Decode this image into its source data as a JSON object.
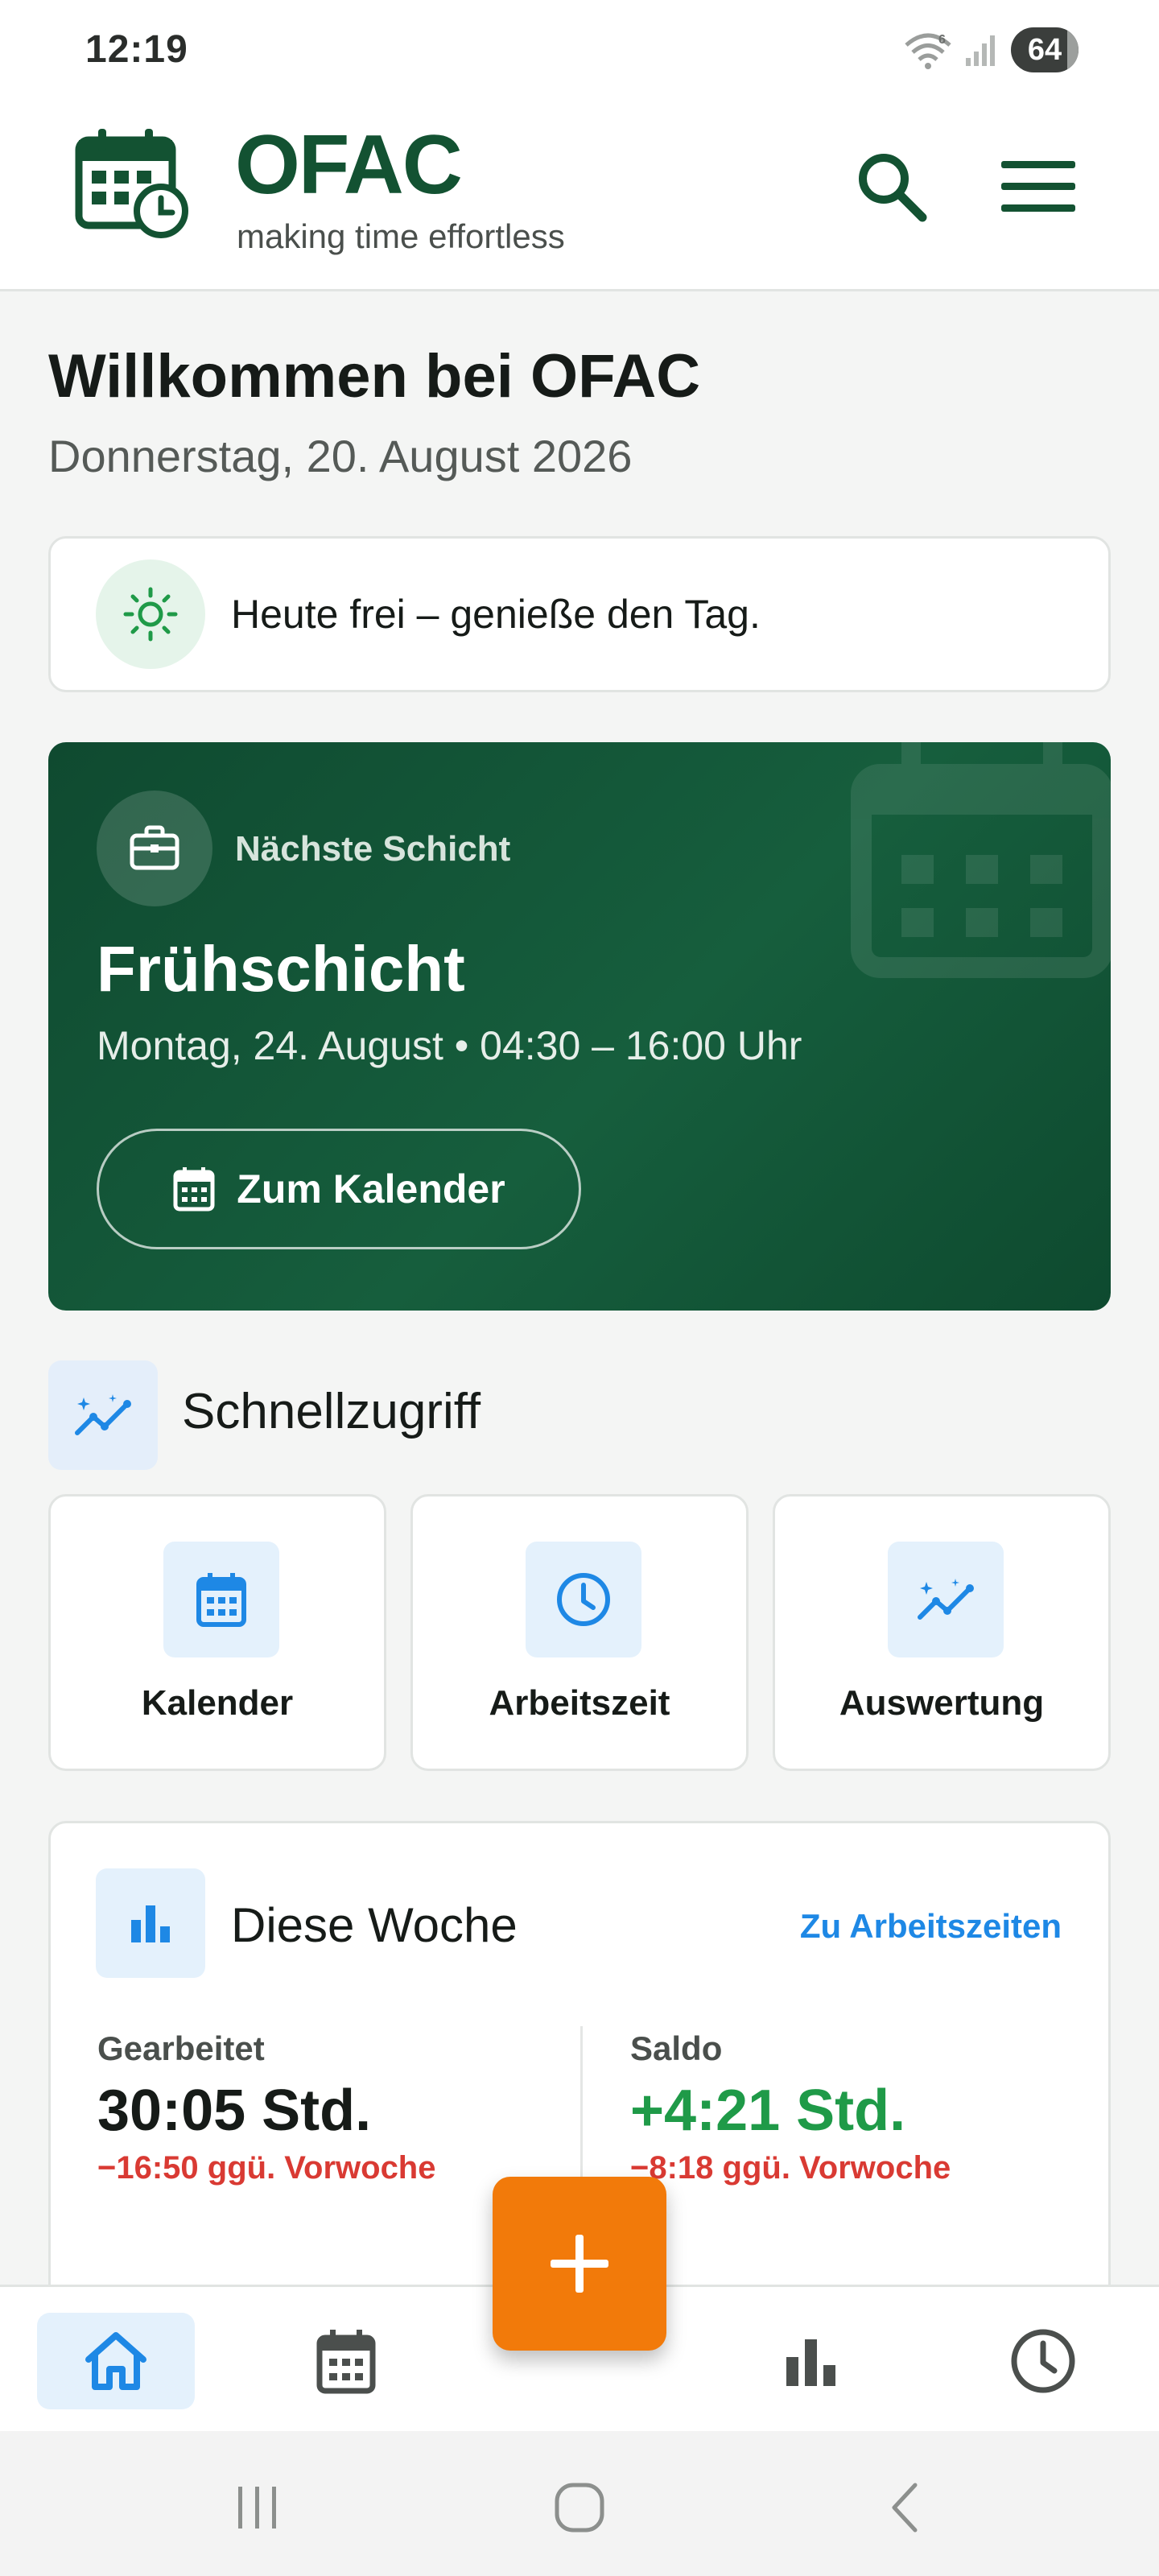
{
  "status_bar": {
    "time": "12:19",
    "battery": "64",
    "signal_badge": "6"
  },
  "header": {
    "brand": "OFAC",
    "tagline": "making time effortless"
  },
  "welcome": {
    "title": "Willkommen bei OFAC",
    "date": "Donnerstag, 20. August 2026"
  },
  "info": {
    "text": "Heute frei – genieße den Tag."
  },
  "shift": {
    "label": "Nächste Schicht",
    "title": "Frühschicht",
    "detail": "Montag, 24. August • 04:30 – 16:00 Uhr",
    "button_label": "Zum Kalender"
  },
  "quick_access": {
    "title": "Schnellzugriff",
    "tiles": [
      {
        "label": "Kalender",
        "icon": "calendar-icon"
      },
      {
        "label": "Arbeitszeit",
        "icon": "clock-icon"
      },
      {
        "label": "Auswertung",
        "icon": "analytics-icon"
      }
    ]
  },
  "week": {
    "title": "Diese Woche",
    "link": "Zu Arbeitszeiten",
    "worked": {
      "label": "Gearbeitet",
      "value": "30:05 Std.",
      "delta": "−16:50 ggü. Vorwoche"
    },
    "balance": {
      "label": "Saldo",
      "value": "+4:21 Std.",
      "delta": "−8:18 ggü. Vorwoche"
    }
  },
  "nav": {
    "items": [
      "home-icon",
      "calendar-icon",
      "bar-chart-icon",
      "clock-icon"
    ]
  },
  "colors": {
    "brand_green": "#135232",
    "accent_blue": "#1e88e5",
    "fab_orange": "#f27a0a",
    "positive": "#1f9a48",
    "negative": "#d93a33"
  }
}
